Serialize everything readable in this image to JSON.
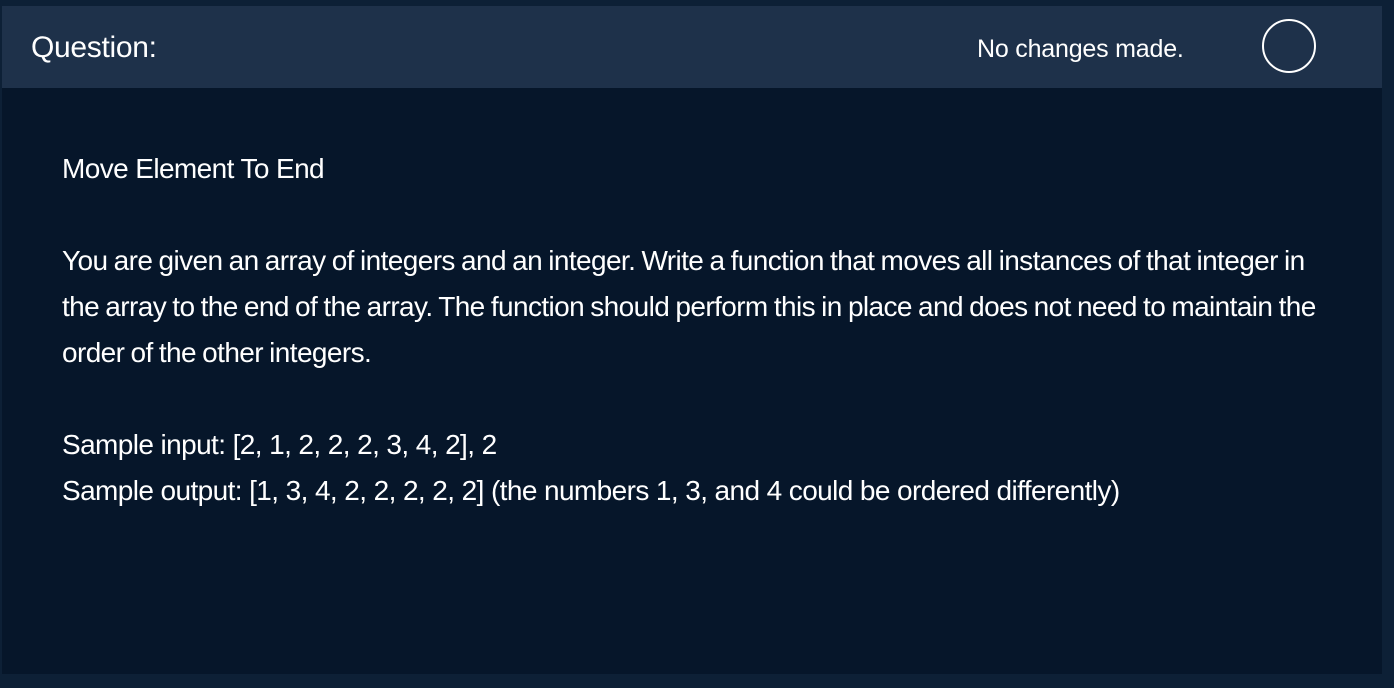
{
  "header": {
    "title": "Question:",
    "status_text": "No changes made."
  },
  "question": {
    "title": "Move Element To End",
    "description": "You are given an array of integers and an integer. Write a function that moves all instances of that integer in the array to the end of the array. The function should perform this in place and does not need to maintain the order of the other integers.",
    "sample_input": "Sample input: [2, 1, 2, 2, 2, 3, 4, 2], 2",
    "sample_output": "Sample output: [1, 3, 4, 2, 2, 2, 2, 2] (the numbers 1, 3, and 4 could be ordered differently)"
  },
  "colors": {
    "page_background": "#0d2036",
    "panel_background": "#06162a",
    "header_background": "#1e314a",
    "text": "#ffffff"
  }
}
